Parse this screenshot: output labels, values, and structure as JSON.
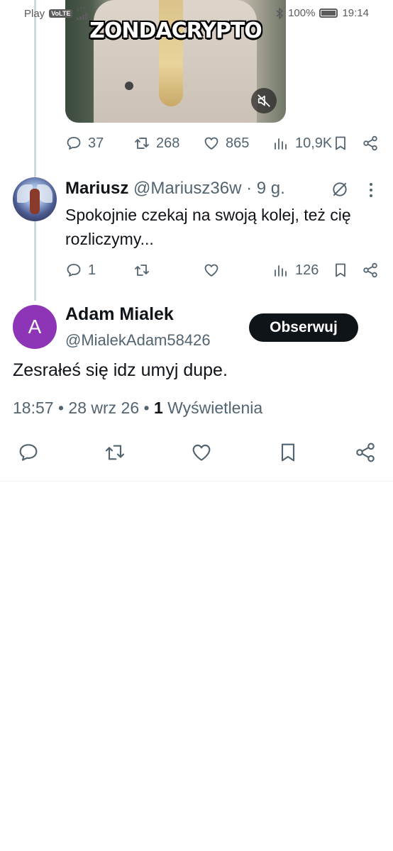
{
  "status_bar": {
    "carrier": "Play",
    "volte": "VoLTE",
    "network": "LTE",
    "battery": "100%",
    "battery_level": 1.0,
    "time": "19:14"
  },
  "media": {
    "overlay_title": "ZONDACRYPTO",
    "muted": true
  },
  "original_post_stats": {
    "replies": "37",
    "reposts": "268",
    "likes": "865",
    "views": "10,9K"
  },
  "reply": {
    "name": "Mariusz",
    "handle": "@Mariusz36w",
    "separator": "·",
    "time": "9 g.",
    "text": "Spokojnie czekaj na swoją kolej, też cię rozliczymy...",
    "stats": {
      "replies": "1",
      "views": "126"
    }
  },
  "main_post": {
    "avatar_letter": "A",
    "avatar_color": "#8e35b7",
    "name": "Adam Mialek",
    "handle": "@MialekAdam58426",
    "follow_label": "Obserwuj",
    "text": "Zesrałeś się idz umyj dupe.",
    "time": "18:57",
    "dot1": "•",
    "date": "28 wrz 26",
    "dot2": "•",
    "views_count": "1",
    "views_label": "Wyświetlenia"
  },
  "colors": {
    "text_primary": "#0f1419",
    "text_secondary": "#536471",
    "thread_line": "#cfd9de"
  },
  "icons": [
    "reply-icon",
    "repost-icon",
    "like-icon",
    "views-icon",
    "bookmark-icon",
    "share-icon",
    "grok-icon",
    "more-icon",
    "mute-icon",
    "bluetooth-icon"
  ]
}
